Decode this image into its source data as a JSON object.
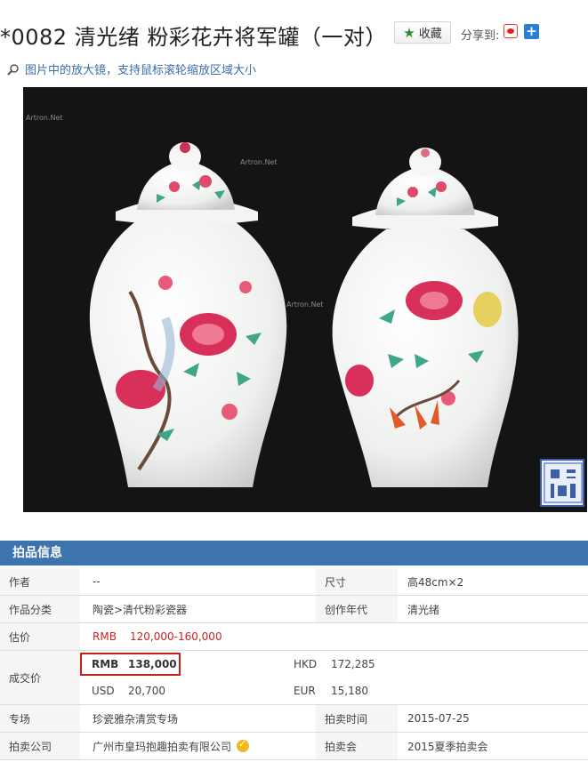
{
  "header": {
    "title": "*0082 清光绪 粉彩花卉将军罐（一对）",
    "favorite_label": "收藏",
    "share_label": "分享到:",
    "share_icons": [
      "weibo-icon",
      "plus-icon"
    ]
  },
  "tip": {
    "text": "图片中的放大镜，支持鼠标滚轮缩放区域大小",
    "icon": "magnifier-icon"
  },
  "photo": {
    "watermarks": [
      "Artron.Net",
      "Artron.Net",
      "Artron.Net"
    ],
    "background": "#141414"
  },
  "info": {
    "section_title": "拍品信息",
    "author_label": "作者",
    "author_value": "--",
    "size_label": "尺寸",
    "size_value": "高48cm×2",
    "category_label": "作品分类",
    "category_value": "陶瓷>清代粉彩瓷器",
    "era_label": "创作年代",
    "era_value": "清光绪",
    "estimate_label": "估价",
    "estimate_currency": "RMB",
    "estimate_value": "120,000-160,000",
    "deal_label": "成交价",
    "deal": {
      "rmb_label": "RMB",
      "rmb_value": "138,000",
      "hkd_label": "HKD",
      "hkd_value": "172,285",
      "usd_label": "USD",
      "usd_value": "20,700",
      "eur_label": "EUR",
      "eur_value": "15,180"
    },
    "session_label": "专场",
    "session_value": "珍瓷雅杂清赏专场",
    "auction_time_label": "拍卖时间",
    "auction_time_value": "2015-07-25",
    "company_label": "拍卖公司",
    "company_value": "广州市皇玛抱趣拍卖有限公司",
    "auction_label": "拍卖会",
    "auction_value": "2015夏季拍卖会"
  },
  "colors": {
    "header_bar": "#3d74ad",
    "price_red": "#cc2222",
    "link_blue": "#3a6ea8",
    "favorite_star": "#2e8a2e"
  }
}
